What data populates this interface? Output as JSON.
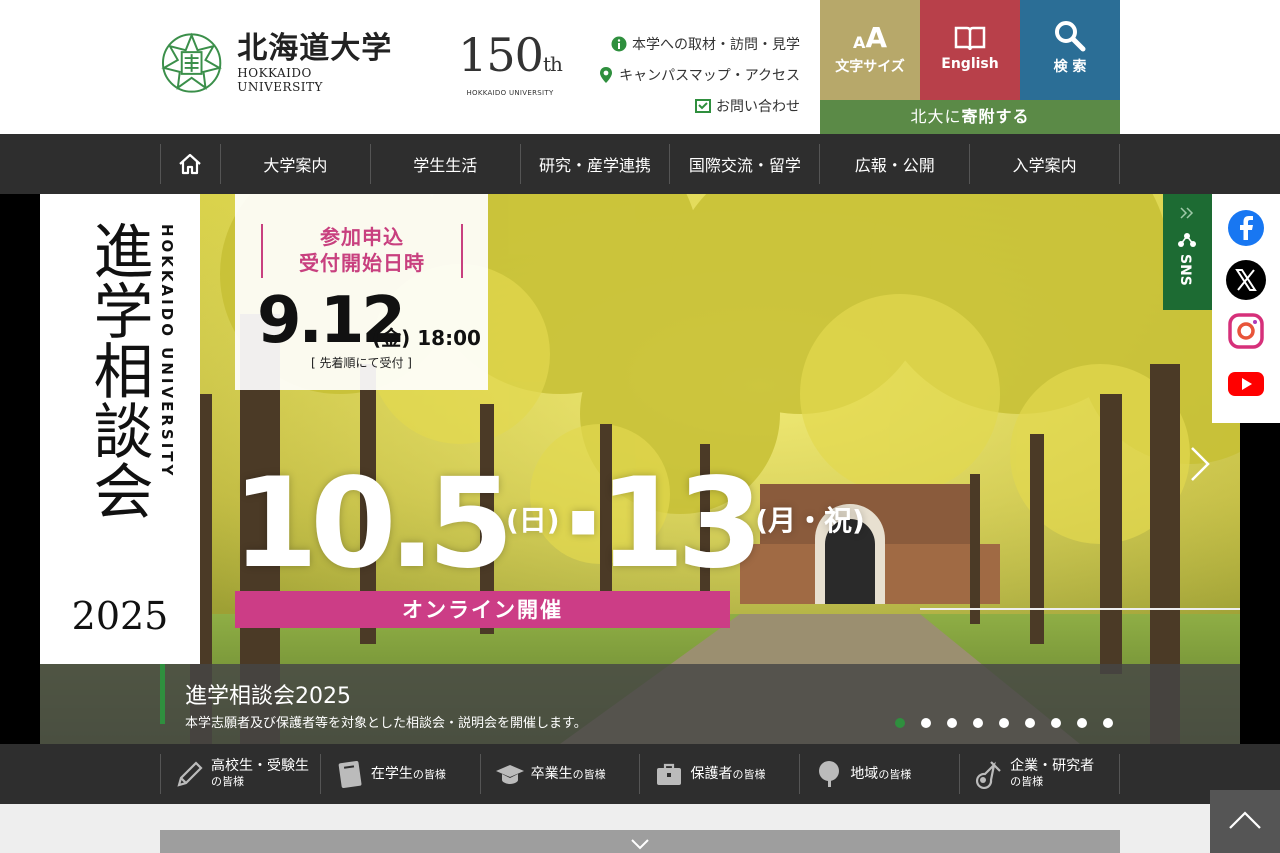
{
  "header": {
    "logo_ja": "北海道大学",
    "logo_en": "HOKKAIDO UNIVERSITY",
    "anniversary_num": "150",
    "anniversary_suffix": "th",
    "anniversary_sub": "HOKKAIDO UNIVERSITY",
    "utility_links": [
      {
        "label": "本学への取材・訪問・見学",
        "icon": "info-icon"
      },
      {
        "label": "キャンパスマップ・アクセス",
        "icon": "map-pin-icon"
      },
      {
        "label": "お問い合わせ",
        "icon": "mail-icon"
      }
    ],
    "tools": {
      "font_size": "文字サイズ",
      "english": "English",
      "search": "検 索"
    },
    "donate_prefix": "北大に",
    "donate_strong": "寄附する"
  },
  "nav": {
    "items": [
      "大学案内",
      "学生生活",
      "研究・産学連携",
      "国際交流・留学",
      "広報・公開",
      "入学案内"
    ]
  },
  "hero": {
    "panel_title": "進学相談会",
    "panel_en": "HOKKAIDO UNIVERSITY",
    "panel_year": "2025",
    "apply_heading_1": "参加申込",
    "apply_heading_2": "受付開始日時",
    "apply_date": "9.12",
    "apply_time": "(金) 18:00",
    "apply_note": "[ 先着順にて受付 ]",
    "big_date_1": "10.5",
    "big_date_1_suffix": "(日)",
    "big_date_2": "·13",
    "big_date_2_suffix": "(月・祝)",
    "online_label": "オンライン開催",
    "caption_title": "進学相談会2025",
    "caption_sub": "本学志願者及び保護者等を対象とした相談会・説明会を開催します。",
    "slide_count": 9,
    "active_slide": 1
  },
  "sns": {
    "tab_label": "SNS",
    "items": [
      "facebook-icon",
      "x-icon",
      "instagram-icon",
      "youtube-icon"
    ]
  },
  "audience": {
    "items": [
      {
        "line1": "高校生・受験生",
        "line2": "の皆様",
        "icon": "pencil-icon"
      },
      {
        "line1": "在学生",
        "line2": "の皆様",
        "icon": "notebook-icon"
      },
      {
        "line1": "卒業生",
        "line2": "の皆様",
        "icon": "graduation-cap-icon"
      },
      {
        "line1": "保護者",
        "line2": "の皆様",
        "icon": "briefcase-icon"
      },
      {
        "line1": "地域",
        "line2": "の皆様",
        "icon": "tree-icon"
      },
      {
        "line1": "企業・研究者",
        "line2": "の皆様",
        "icon": "flask-icon"
      }
    ]
  },
  "colors": {
    "nav_bg": "#2e2e2e",
    "font_size_btn": "#b7a86a",
    "english_btn": "#b8404a",
    "search_btn": "#2b6e96",
    "donate": "#5b8a47",
    "accent_green": "#2f8f3e",
    "accent_pink": "#cc3d86"
  }
}
